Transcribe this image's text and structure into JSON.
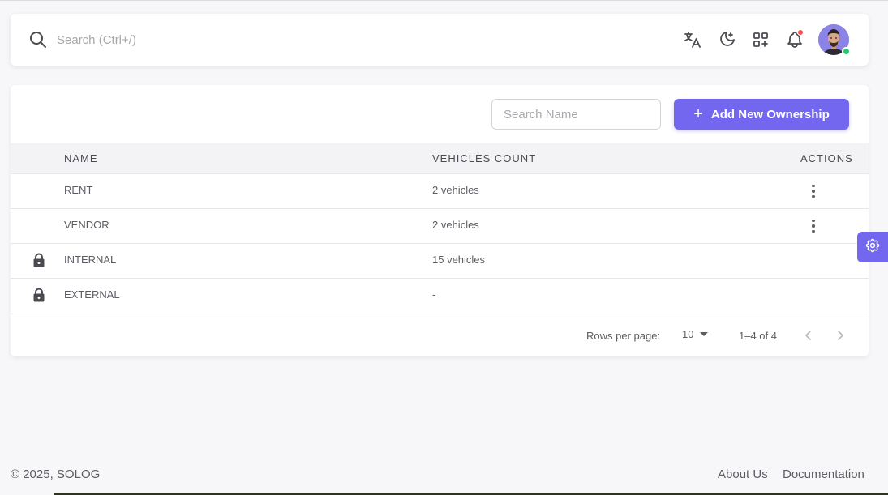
{
  "navbar": {
    "search_placeholder": "Search (Ctrl+/)",
    "icons": [
      "search-icon",
      "translate-icon",
      "theme-toggle-icon",
      "apps-grid-icon",
      "bell-icon"
    ],
    "notification_dot_color": "#ff4c51",
    "online_status_color": "#28c76f"
  },
  "toolbar": {
    "name_search_placeholder": "Search Name",
    "add_button_label": "Add New Ownership",
    "accent_color": "#7367f0"
  },
  "table": {
    "columns": [
      "NAME",
      "VEHICLES COUNT",
      "ACTIONS"
    ],
    "rows": [
      {
        "name": "RENT",
        "vehicles_count": "2 vehicles",
        "locked": false,
        "has_actions": true
      },
      {
        "name": "VENDOR",
        "vehicles_count": "2 vehicles",
        "locked": false,
        "has_actions": true
      },
      {
        "name": "INTERNAL",
        "vehicles_count": "15 vehicles",
        "locked": true,
        "has_actions": false
      },
      {
        "name": "EXTERNAL",
        "vehicles_count": "-",
        "locked": true,
        "has_actions": false
      }
    ]
  },
  "pagination": {
    "rows_per_page_label": "Rows per page:",
    "rows_per_page_value": "10",
    "range_text": "1–4 of 4"
  },
  "footer": {
    "copyright": "© 2025, SOLOG",
    "links": [
      "About Us",
      "Documentation"
    ]
  }
}
